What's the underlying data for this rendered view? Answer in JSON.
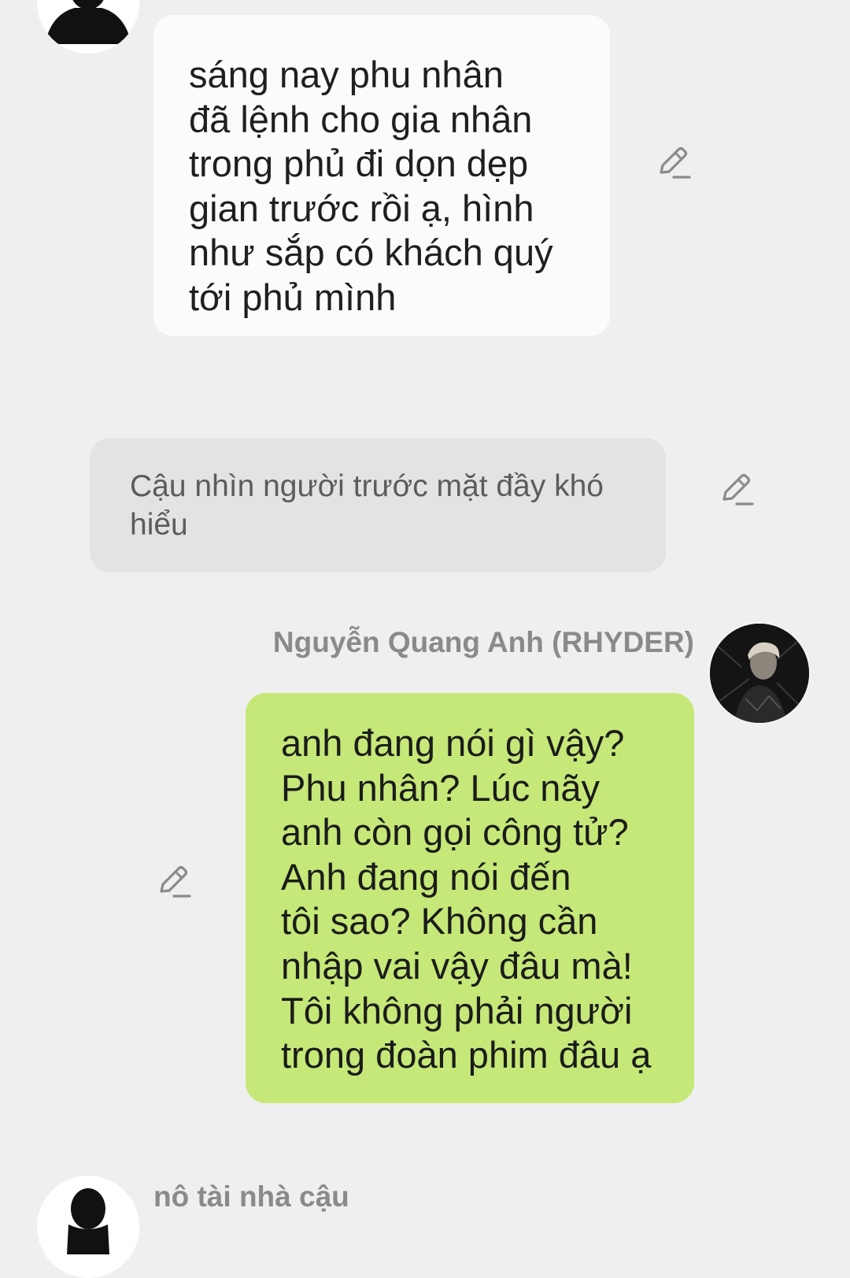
{
  "messages": [
    {
      "role": "incoming",
      "text": "sáng nay phu nhân\nđã lệnh cho gia nhân\ntrong phủ đi dọn dẹp\ngian trước rồi ạ, hình\nnhư sắp có khách quý\ntới phủ mình"
    },
    {
      "role": "narration",
      "text": "Cậu nhìn người trước mặt đầy khó\nhiểu"
    },
    {
      "role": "outgoing",
      "sender": "Nguyễn Quang Anh (RHYDER)",
      "text": "anh đang nói gì vậy?\nPhu nhân? Lúc nãy\nanh còn gọi công tử?\nAnh đang nói đến\ntôi sao? Không cần\nnhập vai vậy đâu mà!\nTôi không phải người\ntrong đoàn phim đâu ạ"
    },
    {
      "role": "incoming",
      "sender": "nô tài nhà cậu"
    }
  ],
  "icons": {
    "edit": "pencil-edit-icon",
    "avatar_placeholder": "silhouette-avatar-icon"
  },
  "colors": {
    "background": "#efefef",
    "incoming_bubble": "#fbfbfb",
    "narration_bubble": "#e3e3e3",
    "outgoing_bubble": "#c5e878",
    "sender_name": "#8a8a8a",
    "narration_text": "#5c5c5c"
  }
}
